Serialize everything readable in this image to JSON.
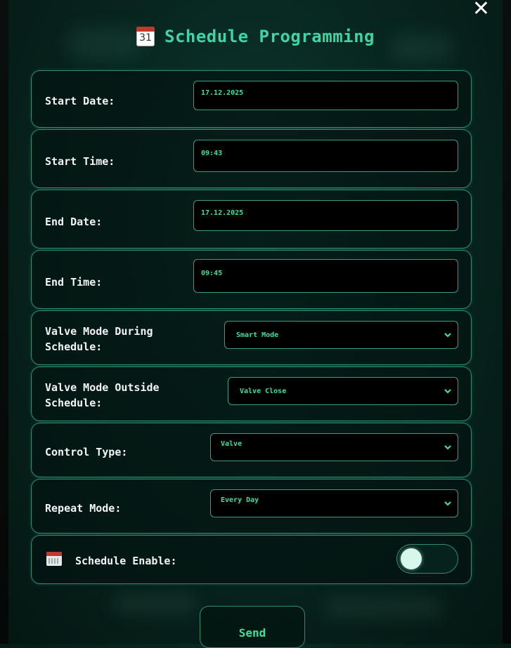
{
  "dialog": {
    "title": "Schedule Programming",
    "calendar_icon_number": "31",
    "close_glyph": "✕"
  },
  "fields": {
    "start_date": {
      "label": "Start Date:",
      "value": "17.12.2025"
    },
    "start_time": {
      "label": "Start Time:",
      "value": "09:43"
    },
    "end_date": {
      "label": "End Date:",
      "value": "17.12.2025"
    },
    "end_time": {
      "label": "End Time:",
      "value": "09:45"
    },
    "valve_mode_during": {
      "label": "Valve Mode During\nSchedule:",
      "value": "Smart Mode"
    },
    "valve_mode_outside": {
      "label": "Valve Mode Outside\nSchedule:",
      "value": "Valve Close"
    },
    "control_type": {
      "label": "Control Type:",
      "value": "Valve"
    },
    "repeat_mode": {
      "label": "Repeat Mode:",
      "value": "Every Day"
    },
    "schedule_enable": {
      "label": "Schedule Enable:",
      "enabled": false
    }
  },
  "actions": {
    "send_label": "Send"
  },
  "colors": {
    "accent": "#3fd4a3",
    "input_text": "#3fe09a",
    "border": "#2d8d73"
  }
}
